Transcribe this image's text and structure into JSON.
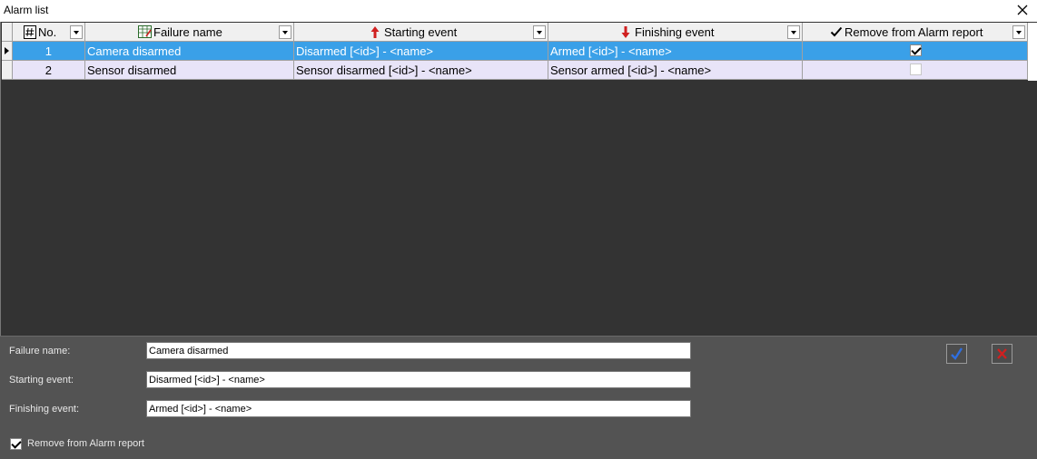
{
  "window": {
    "title": "Alarm list",
    "close_icon": "close-icon"
  },
  "grid": {
    "columns": [
      {
        "key": "no",
        "label": "No.",
        "icon": "hash-icon"
      },
      {
        "key": "failure_name",
        "label": "Failure name",
        "icon": "table-edit-icon"
      },
      {
        "key": "starting_event",
        "label": "Starting event",
        "icon": "arrow-up-red-icon"
      },
      {
        "key": "finishing_event",
        "label": "Finishing event",
        "icon": "arrow-down-red-icon"
      },
      {
        "key": "remove_from_report",
        "label": "Remove from Alarm report",
        "icon": "checkmark-icon"
      }
    ],
    "rows": [
      {
        "no": "1",
        "failure_name": "Camera disarmed",
        "starting_event": "Disarmed [<id>] - <name>",
        "finishing_event": "Armed [<id>] - <name>",
        "remove_from_report": true
      },
      {
        "no": "2",
        "failure_name": "Sensor disarmed",
        "starting_event": "Sensor disarmed [<id>] - <name>",
        "finishing_event": "Sensor armed [<id>] - <name>",
        "remove_from_report": false
      }
    ],
    "colors": {
      "selected_row": "#3aa0e8",
      "normal_row": "#e8e4f8",
      "background": "#333333"
    }
  },
  "editor": {
    "failure_name_label": "Failure name:",
    "failure_name_value": "Camera disarmed",
    "starting_event_label": "Starting event:",
    "starting_event_value": "Disarmed [<id>] - <name>",
    "finishing_event_label": "Finishing event:",
    "finishing_event_value": "Armed [<id>] - <name>",
    "remove_label": "Remove from Alarm report",
    "remove_checked": true,
    "apply_icon": "checkmark-blue-icon",
    "cancel_icon": "cross-red-icon"
  }
}
